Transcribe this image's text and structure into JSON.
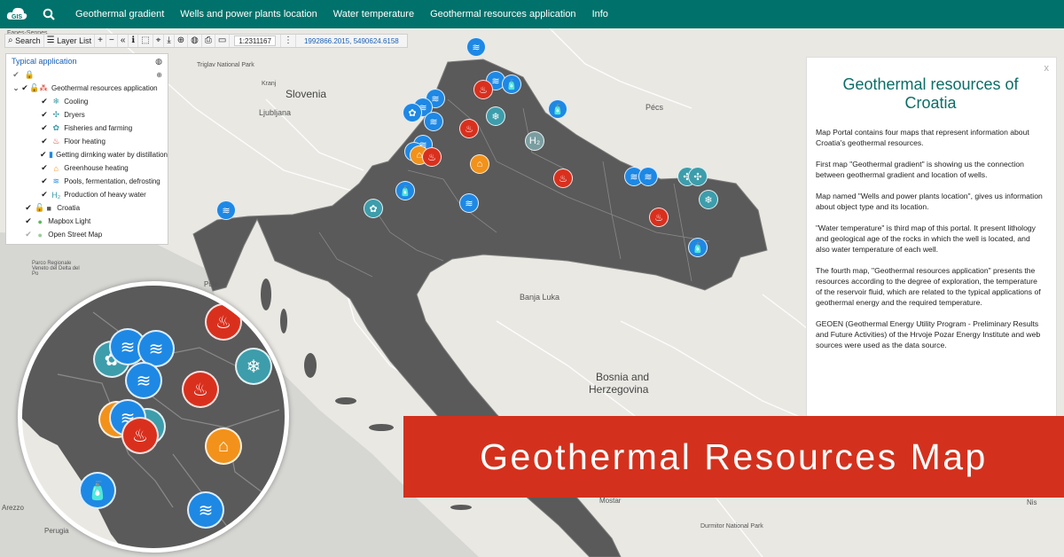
{
  "topbar": {
    "logo_label": "GIS",
    "nav": [
      {
        "label": "Geothermal gradient"
      },
      {
        "label": "Wells and power plants location"
      },
      {
        "label": "Water temperature"
      },
      {
        "label": "Geothermal resources application"
      },
      {
        "label": "Info"
      }
    ]
  },
  "toolbar": {
    "search_label": "Search",
    "layer_list_label": "Layer List",
    "scale": "1:2311167",
    "coordinates": "1992866.2015, 5490624.6158"
  },
  "layer_panel": {
    "title": "Typical application",
    "group_label": "Geothermal resources application",
    "items": [
      {
        "label": "Cooling",
        "icon": "snowflake-icon"
      },
      {
        "label": "Dryers",
        "icon": "fan-icon"
      },
      {
        "label": "Fisheries and farming",
        "icon": "fish-icon"
      },
      {
        "label": "Floor heating",
        "icon": "heating-icon"
      },
      {
        "label": "Getting dirnking water by distillation",
        "icon": "bottle-icon"
      },
      {
        "label": "Greenhouse heating",
        "icon": "greenhouse-icon"
      },
      {
        "label": "Pools, fermentation, defrosting",
        "icon": "waves-icon"
      },
      {
        "label": "Production of heavy water",
        "icon": "h2o-icon"
      }
    ],
    "croatia_label": "Croatia",
    "basemaps": [
      {
        "label": "Mapbox Light"
      },
      {
        "label": "Open Street Map"
      }
    ]
  },
  "info": {
    "close": "x",
    "title": "Geothermal resources of Croatia",
    "paragraphs": [
      "Map Portal contains four maps that represent information about Croatia's geothermal resources.",
      "First map \"Geothermal gradient\" is showing us the connection between geothermal gradient and location of wells.",
      "Map named \"Wells and power plants location\", gives us information about object type and its location.",
      "\"Water temperature\" is third map of this portal. It present lithology and geological age of the rocks in which the well is located, and also water temperature of each well.",
      "The fourth map, \"Geothermal resources application\" presents the resources according to the degree of exploration, the temperature of the reservoir fluid, which are related to the typical applications of geothermal energy and the required temperature.",
      "GEOEN (Geothermal Energy Utility Program - Preliminary Results and Future Activities) of the Hrvoje Pozar Energy Institute and web sources were used as the data source."
    ]
  },
  "banner": {
    "text": "Geothermal Resources Map"
  },
  "map_labels": {
    "slovenia": "Slovenia",
    "ljubljana": "Ljubljana",
    "pecs": "Pécs",
    "banja_luka": "Banja Luka",
    "bosnia": "Bosnia and",
    "herzegovina": "Herzegovina",
    "perugia": "Perugia",
    "mostar": "Mostar",
    "triglav": "Triglav National Park",
    "kranj": "Kranj",
    "fanes": "Fanes-Sennes",
    "pula": "Pula",
    "nis": "Nis",
    "durmitor": "Durmitor National Park",
    "arezzo": "Arezzo",
    "delta": "Parco Regionale Veneto del Delta del Po"
  },
  "colors": {
    "topbar": "#00726b",
    "croatia_fill": "#5a5a5a",
    "banner": "#d3311d",
    "marker_blue": "#1e88e5",
    "marker_red": "#d9301e",
    "marker_teal": "#3d9dab",
    "marker_orange": "#f2921b"
  }
}
